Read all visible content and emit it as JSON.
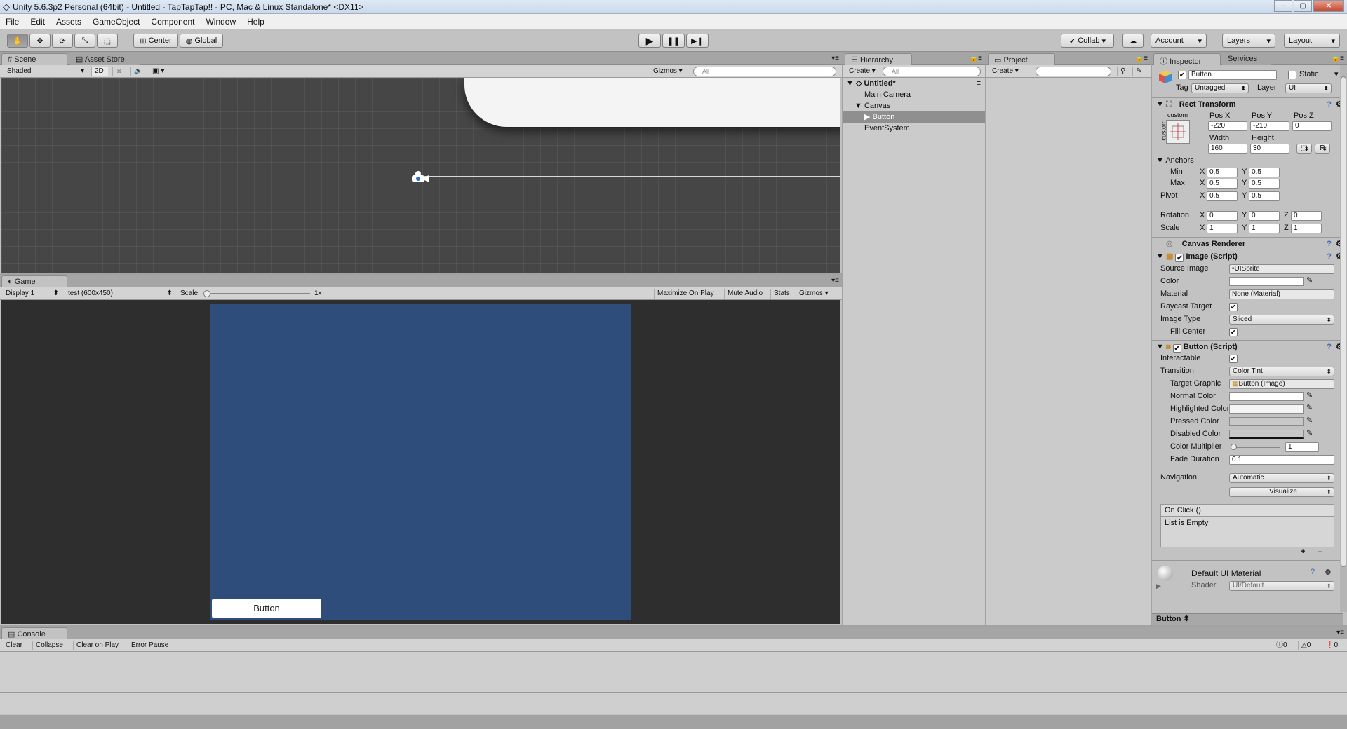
{
  "window": {
    "title": "Unity 5.6.3p2 Personal (64bit) - Untitled - TapTapTap!! - PC, Mac & Linux Standalone* <DX11>",
    "min": "–",
    "max": "▢",
    "close": "✕"
  },
  "menu": [
    "File",
    "Edit",
    "Assets",
    "GameObject",
    "Component",
    "Window",
    "Help"
  ],
  "toolbar": {
    "pivot": "Center",
    "space": "Global",
    "collab": "Collab",
    "account": "Account",
    "layers": "Layers",
    "layout": "Layout"
  },
  "scene": {
    "tab": "Scene",
    "tab2": "Asset Store",
    "shading": "Shaded",
    "mode2d": "2D",
    "gizmos": "Gizmos",
    "search_placeholder": "All"
  },
  "game": {
    "tab": "Game",
    "display": "Display 1",
    "resolution": "test (600x450)",
    "scale_label": "Scale",
    "scale_value": "1x",
    "maximize": "Maximize On Play",
    "mute": "Mute Audio",
    "stats": "Stats",
    "gizmos": "Gizmos",
    "button_label": "Button",
    "canvas_color": "#2f4d7a"
  },
  "hierarchy": {
    "tab": "Hierarchy",
    "create": "Create",
    "search_placeholder": "All",
    "scene_name": "Untitled*",
    "items": [
      "Main Camera",
      "Canvas",
      "Button",
      "EventSystem"
    ]
  },
  "project": {
    "tab": "Project",
    "create": "Create"
  },
  "inspector": {
    "tab": "Inspector",
    "tab2": "Services",
    "object_name": "Button",
    "static_label": "Static",
    "tag_label": "Tag",
    "tag_value": "Untagged",
    "layer_label": "Layer",
    "layer_value": "UI",
    "rect": {
      "title": "Rect Transform",
      "anchor_preset": "custom",
      "anchor_side": "custom",
      "posx_label": "Pos X",
      "posy_label": "Pos Y",
      "posz_label": "Pos Z",
      "posx": "-220",
      "posy": "-210",
      "posz": "0",
      "width_label": "Width",
      "height_label": "Height",
      "width": "160",
      "height": "30",
      "r_button": "R",
      "anchors_label": "Anchors",
      "min_label": "Min",
      "max_label": "Max",
      "pivot_label": "Pivot",
      "min_x": "0.5",
      "min_y": "0.5",
      "max_x": "0.5",
      "max_y": "0.5",
      "pivot_x": "0.5",
      "pivot_y": "0.5",
      "rotation_label": "Rotation",
      "rot_x": "0",
      "rot_y": "0",
      "rot_z": "0",
      "scale_label": "Scale",
      "scale_x": "1",
      "scale_y": "1",
      "scale_z": "1",
      "x": "X",
      "y": "Y",
      "z": "Z"
    },
    "canvas_renderer": "Canvas Renderer",
    "image": {
      "title": "Image (Script)",
      "source_label": "Source Image",
      "source_value": "UISprite",
      "color_label": "Color",
      "material_label": "Material",
      "material_value": "None (Material)",
      "raycast_label": "Raycast Target",
      "type_label": "Image Type",
      "type_value": "Sliced",
      "fill_label": "Fill Center"
    },
    "button": {
      "title": "Button (Script)",
      "interactable_label": "Interactable",
      "transition_label": "Transition",
      "transition_value": "Color Tint",
      "target_label": "Target Graphic",
      "target_value": "Button (Image)",
      "normal_label": "Normal Color",
      "highlighted_label": "Highlighted Color",
      "pressed_label": "Pressed Color",
      "disabled_label": "Disabled Color",
      "multiplier_label": "Color Multiplier",
      "multiplier_value": "1",
      "fade_label": "Fade Duration",
      "fade_value": "0.1",
      "navigation_label": "Navigation",
      "navigation_value": "Automatic",
      "visualize": "Visualize",
      "onclick_title": "On Click ()",
      "onclick_empty": "List is Empty",
      "plus": "+",
      "minus": "–"
    },
    "material": {
      "title": "Default UI Material",
      "shader_label": "Shader",
      "shader_value": "UI/Default"
    },
    "footer_label": "Button"
  },
  "console": {
    "tab": "Console",
    "buttons": [
      "Clear",
      "Collapse",
      "Clear on Play",
      "Error Pause"
    ],
    "info_count": "0",
    "warn_count": "0",
    "error_count": "0"
  }
}
